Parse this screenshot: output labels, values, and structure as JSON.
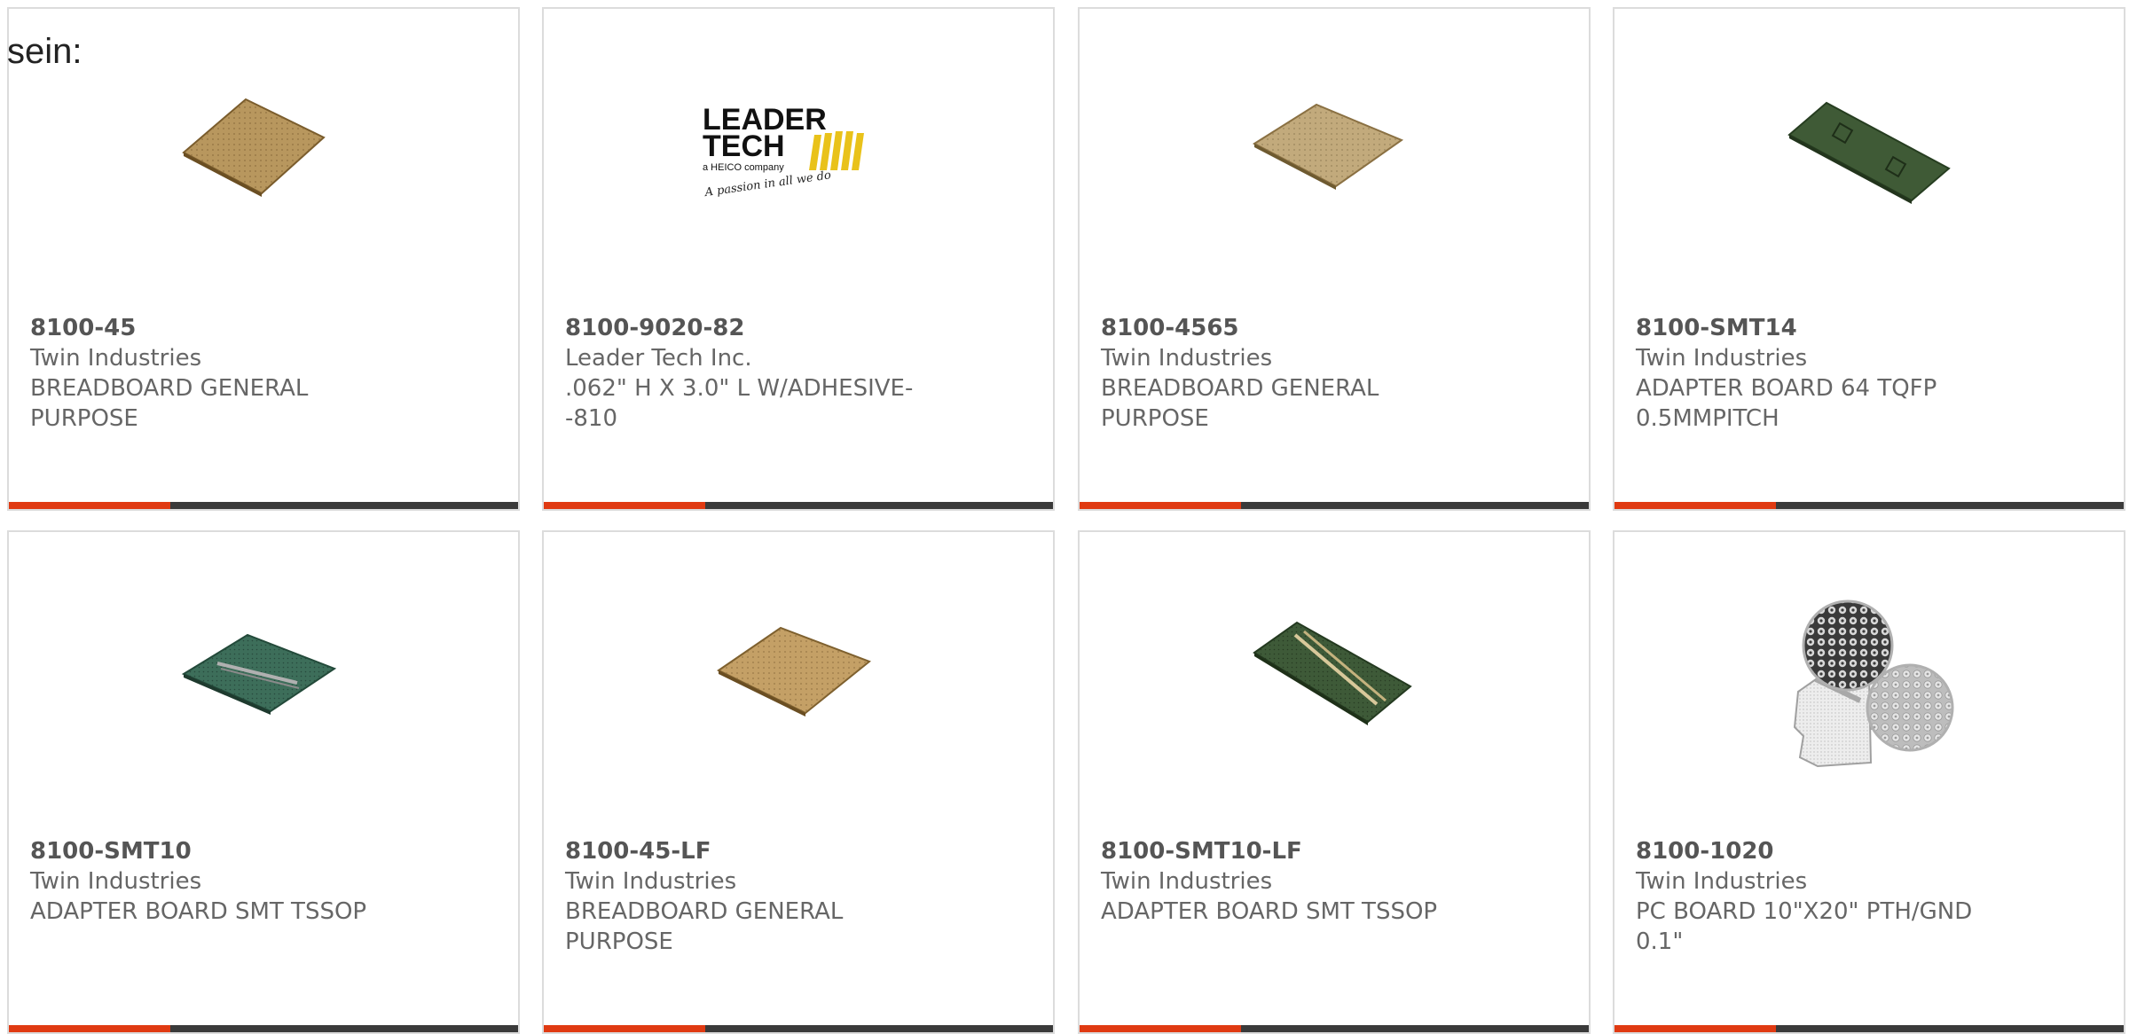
{
  "lead_text": "sein:",
  "accent_color": "#e03a12",
  "bar_color": "#3a3a3a",
  "cards": [
    {
      "part": "8100-45",
      "mfr": "Twin Industries",
      "desc": "BREADBOARD GENERAL PURPOSE",
      "image": "tan-breadboard"
    },
    {
      "part": "8100-9020-82",
      "mfr": "Leader Tech Inc.",
      "desc": ".062\" H X 3.0\" L W/ADHESIVE--810",
      "image": "leader-tech-logo",
      "logo": {
        "line1": "LEADER",
        "line2": "TECH",
        "sub": "a HEICO company",
        "tagline": "A passion in all we do"
      }
    },
    {
      "part": "8100-4565",
      "mfr": "Twin Industries",
      "desc": "BREADBOARD GENERAL PURPOSE",
      "image": "tan-breadboard"
    },
    {
      "part": "8100-SMT14",
      "mfr": "Twin Industries",
      "desc": "ADAPTER BOARD 64 TQFP 0.5MMPITCH",
      "image": "green-adapter-board-tqfp"
    },
    {
      "part": "8100-SMT10",
      "mfr": "Twin Industries",
      "desc": "ADAPTER BOARD SMT TSSOP",
      "image": "green-adapter-board-tssop"
    },
    {
      "part": "8100-45-LF",
      "mfr": "Twin Industries",
      "desc": "BREADBOARD GENERAL PURPOSE",
      "image": "tan-breadboard"
    },
    {
      "part": "8100-SMT10-LF",
      "mfr": "Twin Industries",
      "desc": "ADAPTER BOARD SMT TSSOP",
      "image": "green-adapter-board-tssop"
    },
    {
      "part": "8100-1020",
      "mfr": "Twin Industries",
      "desc": "PC BOARD 10\"X20\" PTH/GND 0.1\"",
      "image": "pc-board-pattern-closeup"
    }
  ]
}
